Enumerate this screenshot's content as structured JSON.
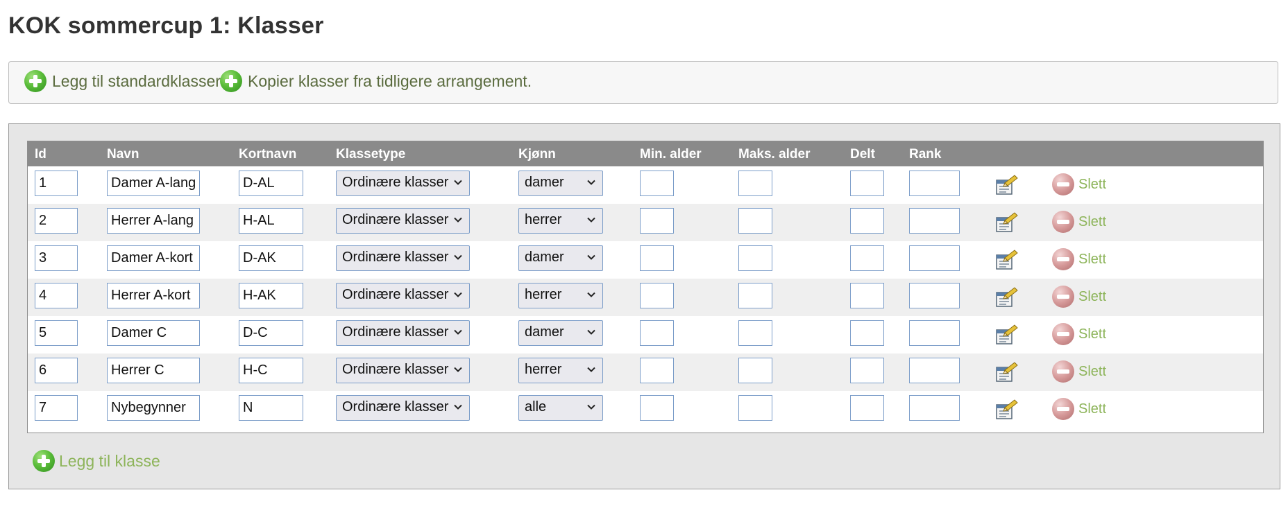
{
  "page": {
    "title": "KOK sommercup 1: Klasser"
  },
  "toolbar": {
    "add_standard_label": "Legg til standardklasser",
    "copy_label": "Kopier klasser fra tidligere arrangement."
  },
  "table": {
    "headers": {
      "id": "Id",
      "name": "Navn",
      "short": "Kortnavn",
      "type": "Klassetype",
      "gender": "Kjønn",
      "min_age": "Min. alder",
      "max_age": "Maks. alder",
      "split": "Delt",
      "rank": "Rank"
    },
    "rows": [
      {
        "id": "1",
        "name": "Damer A-lang",
        "short": "D-AL",
        "type": "Ordinære klasser",
        "gender": "damer",
        "min_age": "",
        "max_age": "",
        "split": "",
        "rank": "",
        "delete": "Slett"
      },
      {
        "id": "2",
        "name": "Herrer A-lang",
        "short": "H-AL",
        "type": "Ordinære klasser",
        "gender": "herrer",
        "min_age": "",
        "max_age": "",
        "split": "",
        "rank": "",
        "delete": "Slett"
      },
      {
        "id": "3",
        "name": "Damer A-kort",
        "short": "D-AK",
        "type": "Ordinære klasser",
        "gender": "damer",
        "min_age": "",
        "max_age": "",
        "split": "",
        "rank": "",
        "delete": "Slett"
      },
      {
        "id": "4",
        "name": "Herrer A-kort",
        "short": "H-AK",
        "type": "Ordinære klasser",
        "gender": "herrer",
        "min_age": "",
        "max_age": "",
        "split": "",
        "rank": "",
        "delete": "Slett"
      },
      {
        "id": "5",
        "name": "Damer C",
        "short": "D-C",
        "type": "Ordinære klasser",
        "gender": "damer",
        "min_age": "",
        "max_age": "",
        "split": "",
        "rank": "",
        "delete": "Slett"
      },
      {
        "id": "6",
        "name": "Herrer C",
        "short": "H-C",
        "type": "Ordinære klasser",
        "gender": "herrer",
        "min_age": "",
        "max_age": "",
        "split": "",
        "rank": "",
        "delete": "Slett"
      },
      {
        "id": "7",
        "name": "Nybegynner",
        "short": "N",
        "type": "Ordinære klasser",
        "gender": "alle",
        "min_age": "",
        "max_age": "",
        "split": "",
        "rank": "",
        "delete": "Slett"
      }
    ]
  },
  "footer": {
    "add_class_label": "Legg til klasse"
  },
  "icons": {
    "add": "plus-circle-icon",
    "delete": "minus-circle-icon",
    "edit": "edit-properties-icon",
    "dropdown": "chevron-down-icon"
  },
  "colors": {
    "link_dark": "#5a6b3e",
    "link_green": "#8db45a",
    "header_bg": "#8a8a8a",
    "input_border": "#7a9cc8"
  }
}
